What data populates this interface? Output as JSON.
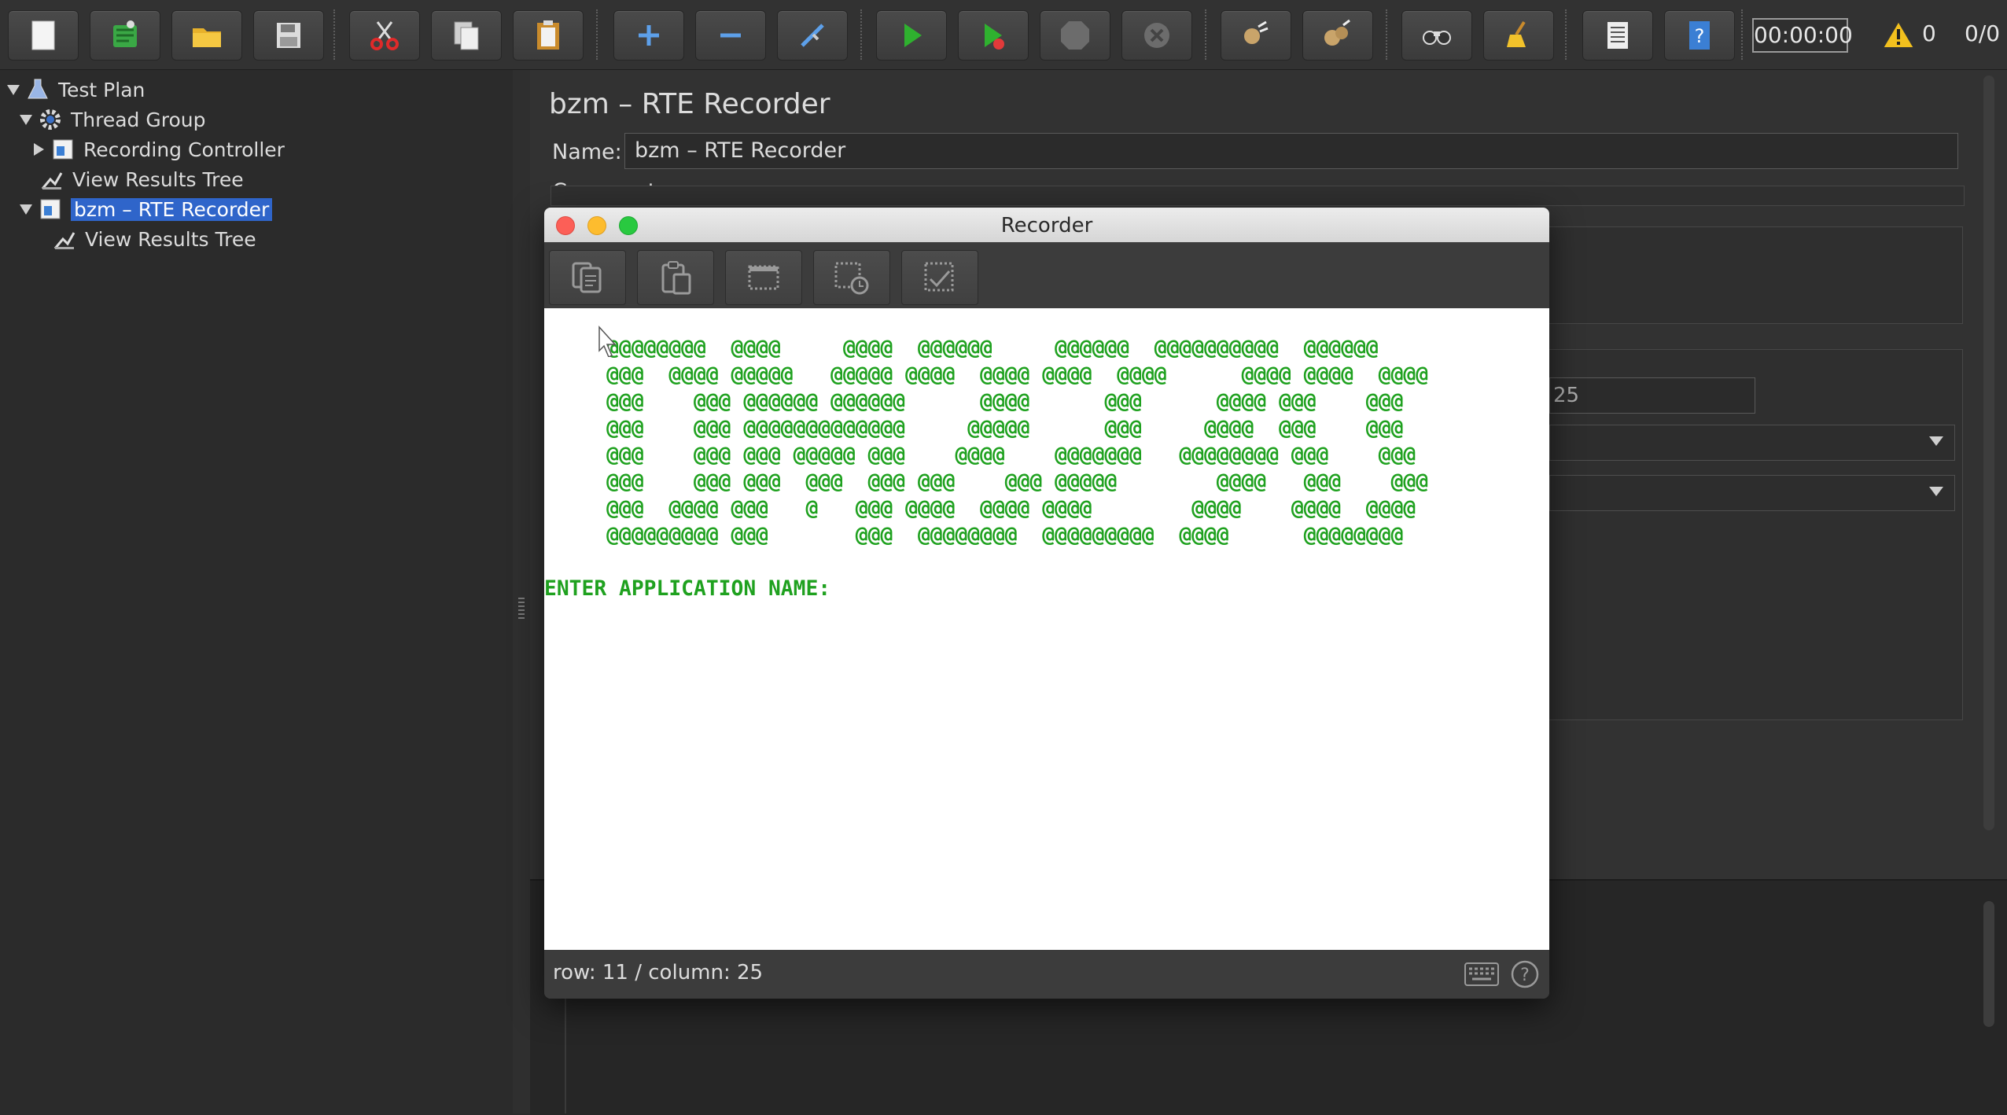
{
  "toolbar": {
    "buttons": [
      "new",
      "templates",
      "open",
      "save",
      "cut",
      "copy",
      "paste",
      "expand-all",
      "collapse-all",
      "toggle",
      "start",
      "start-no-pauses",
      "stop",
      "shutdown",
      "clear",
      "clear-all",
      "search",
      "reset-search",
      "function-helper",
      "help"
    ],
    "timer": "00:00:00",
    "warning_count": "0",
    "thread_count": "0/0"
  },
  "tree": {
    "items": [
      {
        "label": "Test Plan",
        "icon": "flask-icon",
        "expanded": true
      },
      {
        "label": "Thread Group",
        "icon": "gear-icon",
        "expanded": true
      },
      {
        "label": "Recording Controller",
        "icon": "controller-icon",
        "expanded": false
      },
      {
        "label": "View Results Tree",
        "icon": "listener-icon"
      },
      {
        "label": "bzm – RTE Recorder",
        "icon": "controller-icon",
        "expanded": true,
        "selected": true
      },
      {
        "label": "View Results Tree",
        "icon": "listener-icon"
      }
    ]
  },
  "panel": {
    "title": "bzm – RTE Recorder",
    "name_label": "Name:",
    "name_value": "bzm – RTE Recorder",
    "comments_label": "Comments:",
    "partial_value": "25"
  },
  "recorder": {
    "title": "Recorder",
    "toolbar_icons": [
      "copy-icon",
      "paste-icon",
      "select-area-icon",
      "wait-area-icon",
      "wait-text-icon"
    ],
    "terminal_lines": [
      "     @@@@@@@@  @@@@     @@@@  @@@@@@     @@@@@@  @@@@@@@@@@  @@@@@@",
      "     @@@  @@@@ @@@@@   @@@@@ @@@@  @@@@ @@@@  @@@@      @@@@ @@@@  @@@@",
      "     @@@    @@@ @@@@@@ @@@@@@      @@@@      @@@      @@@@ @@@    @@@",
      "     @@@    @@@ @@@@@@@@@@@@@     @@@@@      @@@     @@@@  @@@    @@@",
      "     @@@    @@@ @@@ @@@@@ @@@    @@@@    @@@@@@@   @@@@@@@@ @@@    @@@",
      "     @@@    @@@ @@@  @@@  @@@ @@@    @@@ @@@@@        @@@@   @@@    @@@",
      "     @@@  @@@@ @@@   @   @@@ @@@@  @@@@ @@@@        @@@@    @@@@  @@@@",
      "     @@@@@@@@@ @@@       @@@  @@@@@@@@  @@@@@@@@@  @@@@      @@@@@@@@",
      "",
      "ENTER APPLICATION NAME:"
    ],
    "status": "row: 11 / column: 25"
  }
}
